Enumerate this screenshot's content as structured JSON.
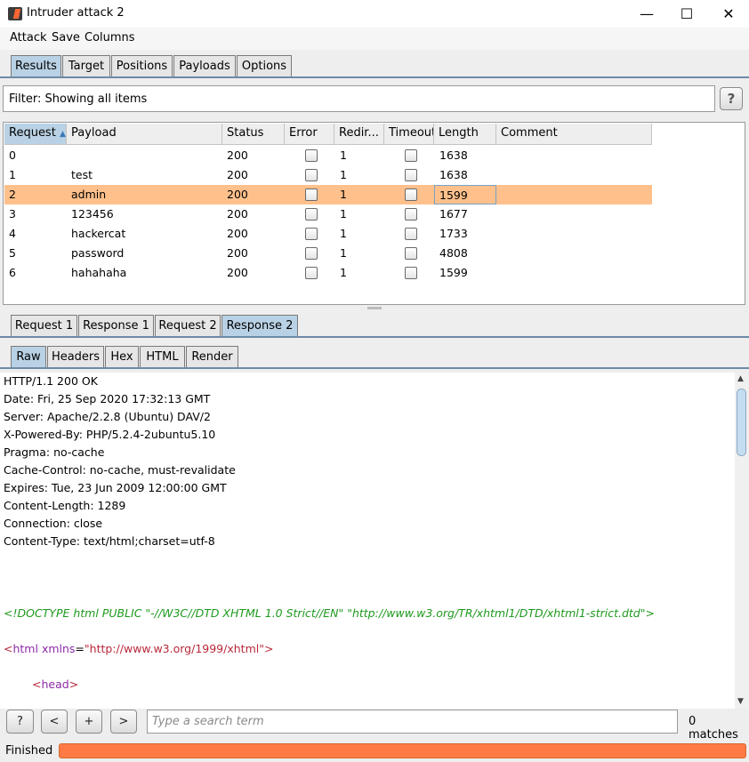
{
  "window": {
    "title": "Intruder attack 2",
    "minimize": "—",
    "maximize": "☐",
    "close": "✕"
  },
  "menu": [
    "Attack",
    "Save",
    "Columns"
  ],
  "main_tabs": [
    "Results",
    "Target",
    "Positions",
    "Payloads",
    "Options"
  ],
  "filter": {
    "text": "Filter: Showing all items",
    "help": "?"
  },
  "table": {
    "headers": [
      "Request",
      "Payload",
      "Status",
      "Error",
      "Redir...",
      "Timeout",
      "Length",
      "Comment"
    ],
    "sort_indicator": "▲",
    "rows": [
      {
        "request": "0",
        "payload": "",
        "status": "200",
        "redir": "1",
        "length": "1638"
      },
      {
        "request": "1",
        "payload": "test",
        "status": "200",
        "redir": "1",
        "length": "1638"
      },
      {
        "request": "2",
        "payload": "admin",
        "status": "200",
        "redir": "1",
        "length": "1599"
      },
      {
        "request": "3",
        "payload": "123456",
        "status": "200",
        "redir": "1",
        "length": "1677"
      },
      {
        "request": "4",
        "payload": "hackercat",
        "status": "200",
        "redir": "1",
        "length": "1733"
      },
      {
        "request": "5",
        "payload": "password",
        "status": "200",
        "redir": "1",
        "length": "4808"
      },
      {
        "request": "6",
        "payload": "hahahaha",
        "status": "200",
        "redir": "1",
        "length": "1599"
      }
    ],
    "selected_index": 2
  },
  "reqres_tabs": [
    "Request 1",
    "Response 1",
    "Request 2",
    "Response 2"
  ],
  "view_tabs": [
    "Raw",
    "Headers",
    "Hex",
    "HTML",
    "Render"
  ],
  "response_lines": [
    "HTTP/1.1 200 OK",
    "Date: Fri, 25 Sep 2020 17:32:13 GMT",
    "Server: Apache/2.2.8 (Ubuntu) DAV/2",
    "X-Powered-By: PHP/5.2.4-2ubuntu5.10",
    "Pragma: no-cache",
    "Cache-Control: no-cache, must-revalidate",
    "Expires: Tue, 23 Jun 2009 12:00:00 GMT",
    "Content-Length: 1289",
    "Connection: close",
    "Content-Type: text/html;charset=utf-8"
  ],
  "doctype_line": "<!DOCTYPE html PUBLIC \"-//W3C//DTD XHTML 1.0 Strict//EN\" \"http://www.w3.org/TR/xhtml1/DTD/xhtml1-strict.dtd\">",
  "html_line": {
    "open": "<",
    "tag": "html",
    "attr": " xmlns",
    "eq": "=",
    "value": "\"http://www.w3.org/1999/xhtml\"",
    "close": ">"
  },
  "head_line": {
    "open": "<",
    "tag": "head",
    "close": ">"
  },
  "search": {
    "help": "?",
    "prev": "<",
    "add": "+",
    "next": ">",
    "placeholder": "Type a search term",
    "matches": "0 matches"
  },
  "status": {
    "text": "Finished",
    "progress": 1.0,
    "progress_color": "#ff7a45"
  }
}
